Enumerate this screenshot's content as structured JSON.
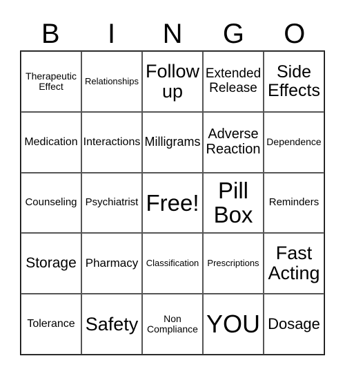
{
  "header": [
    "B",
    "I",
    "N",
    "G",
    "O"
  ],
  "cells": [
    {
      "text": "Therapeutic Effect",
      "size": 14
    },
    {
      "text": "Relationships",
      "size": 13
    },
    {
      "text": "Follow up",
      "size": 27
    },
    {
      "text": "Extended Release",
      "size": 19
    },
    {
      "text": "Side Effects",
      "size": 25
    },
    {
      "text": "Medication",
      "size": 16
    },
    {
      "text": "Interactions",
      "size": 16
    },
    {
      "text": "Milligrams",
      "size": 18
    },
    {
      "text": "Adverse Reaction",
      "size": 20
    },
    {
      "text": "Dependence",
      "size": 14
    },
    {
      "text": "Counseling",
      "size": 15
    },
    {
      "text": "Psychiatrist",
      "size": 15
    },
    {
      "text": "Free!",
      "size": 33
    },
    {
      "text": "Pill Box",
      "size": 33
    },
    {
      "text": "Reminders",
      "size": 15
    },
    {
      "text": "Storage",
      "size": 21
    },
    {
      "text": "Pharmacy",
      "size": 17
    },
    {
      "text": "Classification",
      "size": 13
    },
    {
      "text": "Prescriptions",
      "size": 13
    },
    {
      "text": "Fast Acting",
      "size": 27
    },
    {
      "text": "Tolerance",
      "size": 16
    },
    {
      "text": "Safety",
      "size": 27
    },
    {
      "text": "Non Compliance",
      "size": 14
    },
    {
      "text": "YOU",
      "size": 36
    },
    {
      "text": "Dosage",
      "size": 22
    }
  ]
}
